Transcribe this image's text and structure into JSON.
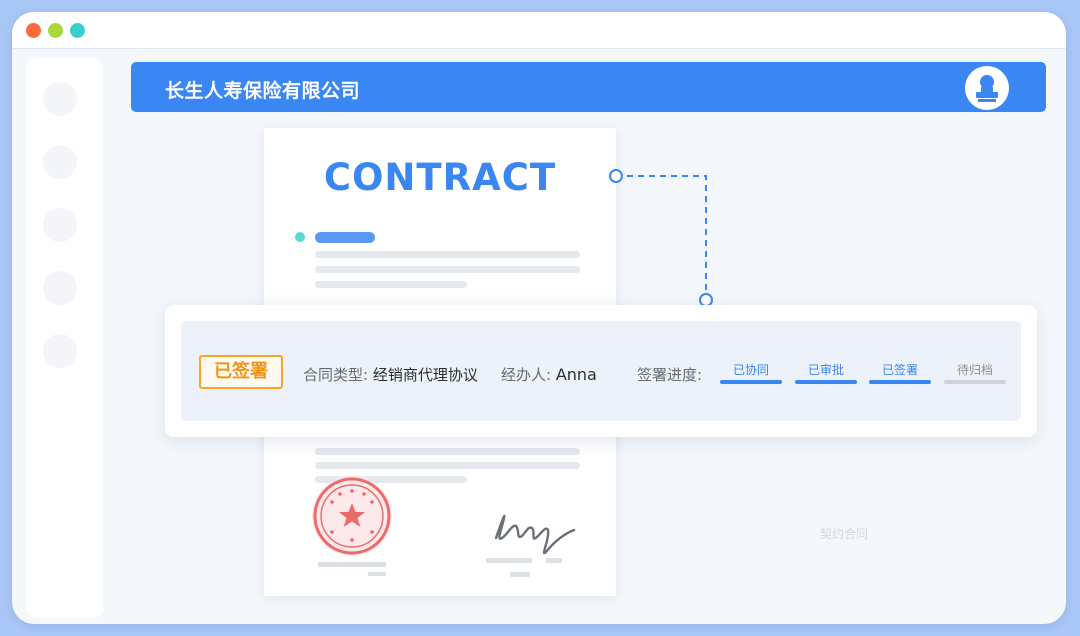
{
  "window": {
    "traffic_colors": [
      "#fd6a3a",
      "#a7d93a",
      "#3bcfcb"
    ]
  },
  "header": {
    "company_name": "长生人寿保险有限公司",
    "avatar_icon": "user-stamp-icon"
  },
  "document": {
    "title": "CONTRACT",
    "seal_icon": "red-star-seal-icon",
    "signature_icon": "handwritten-signature-icon"
  },
  "contract_card": {
    "status_badge": "已签署",
    "type_label": "合同类型: ",
    "type_value": "经销商代理协议",
    "handler_label": "经办人: ",
    "handler_value": "Anna",
    "progress_label": "签署进度:",
    "steps": [
      {
        "label": "已协同",
        "state": "done"
      },
      {
        "label": "已审批",
        "state": "done"
      },
      {
        "label": "已签署",
        "state": "done"
      },
      {
        "label": "待归档",
        "state": "pending"
      }
    ]
  },
  "colors": {
    "accent": "#3a86f2",
    "badge": "#f4a72b",
    "seal": "#ec6a6a",
    "bullet": "#5ad7cf"
  },
  "watermark": "契约合同"
}
